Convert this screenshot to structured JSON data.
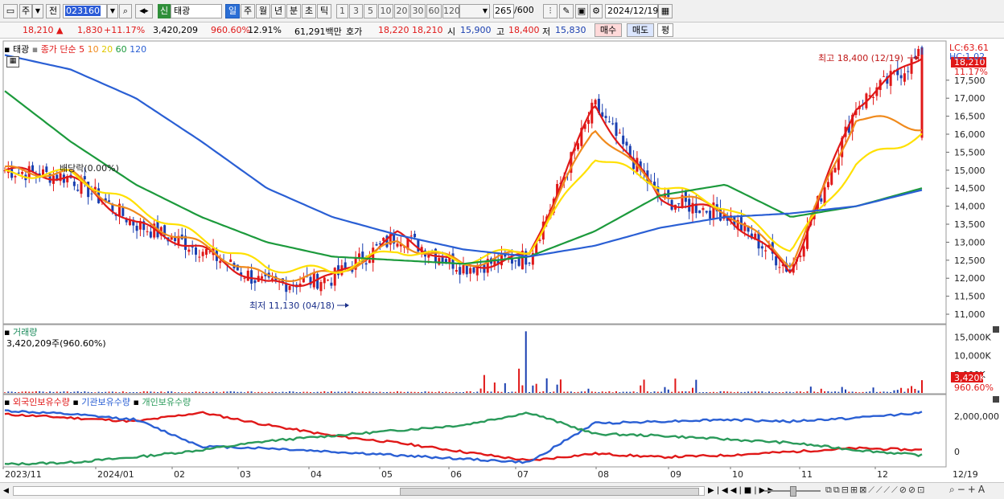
{
  "toolbar": {
    "market_btn": "주",
    "prev_btn": "전",
    "code": "023160",
    "new_badge": "신",
    "stock_name": "태광",
    "periods": [
      "일",
      "주",
      "월",
      "년",
      "분",
      "초",
      "틱"
    ],
    "active_period": "일",
    "nums": [
      "1",
      "3",
      "5",
      "10",
      "20",
      "30",
      "60",
      "120"
    ],
    "count": "265",
    "count_total": "/600",
    "date": "2024/12/19"
  },
  "info": {
    "price": "18,210",
    "change_arrow": "▲",
    "change": "1,830",
    "change_pct": "+11.17%",
    "volume": "3,420,209",
    "volume_ratio": "960.60%",
    "turnover": "12.91%",
    "amount": "61,291백만",
    "quote_label": "호가",
    "ask": "18,220",
    "bid": "18,210",
    "open_label": "시",
    "open": "15,900",
    "high_label": "고",
    "high": "18,400",
    "low_label": "저",
    "low": "15,830",
    "buy_btn": "매수",
    "sell_btn": "매도",
    "eval_btn": "평"
  },
  "price_panel": {
    "stock": "태광",
    "ma_title": "종가 단순",
    "ma_periods": [
      "5",
      "10",
      "20",
      "60",
      "120"
    ],
    "ma_colors": [
      "#e01818",
      "#f08a1c",
      "#ffe000",
      "#1c9a3c",
      "#2a5fd4"
    ],
    "lc": "LC:63.61",
    "hc": "HC:1.02",
    "current_price": "18,210",
    "current_pct": "11.17%",
    "allocation": "배당락(0.00%)",
    "high_note": "최고 18,400 (12/19)",
    "low_note": "최저 11,130 (04/18)",
    "y_ticks": [
      "17,500",
      "17,000",
      "16,500",
      "16,000",
      "15,500",
      "15,000",
      "14,500",
      "14,000",
      "13,500",
      "13,000",
      "12,500",
      "12,000",
      "11,500",
      "11,000"
    ]
  },
  "volume_panel": {
    "title": "거래량",
    "current": "3,420,209주(960.60%)",
    "y_ticks": [
      "15,000K",
      "10,000K",
      "5,000K"
    ],
    "badge": "3,420K",
    "badge_pct": "960.60%"
  },
  "holding_panel": {
    "legend": [
      "외국인보유수량",
      "기관보유수량",
      "개인보유수량"
    ],
    "colors": [
      "#e01818",
      "#2a5fd4",
      "#2a9a5a"
    ],
    "y_ticks": [
      "2,000,000",
      "0"
    ]
  },
  "x_labels": [
    "2023/11",
    "2024/01",
    "02",
    "03",
    "04",
    "05",
    "06",
    "07",
    "08",
    "09",
    "10",
    "11",
    "12",
    "12/19"
  ],
  "chart_data": {
    "type": "line",
    "title": "태광 종가 단순이동평균",
    "x": [
      "2023/11",
      "2023/12",
      "2024/01",
      "02",
      "03",
      "04",
      "05",
      "06",
      "07",
      "08",
      "09",
      "10",
      "11",
      "12",
      "12/19"
    ],
    "series": [
      {
        "name": "5",
        "values": [
          15000,
          14800,
          13500,
          12800,
          11800,
          12000,
          13200,
          12300,
          12600,
          16800,
          14200,
          13800,
          12200,
          16800,
          18210
        ]
      },
      {
        "name": "10",
        "values": [
          15000,
          14900,
          13700,
          12900,
          12000,
          12100,
          13000,
          12400,
          12700,
          16200,
          14400,
          13900,
          12400,
          16500,
          16200
        ]
      },
      {
        "name": "20",
        "values": [
          14900,
          14900,
          14000,
          13100,
          12300,
          12200,
          12800,
          12500,
          12800,
          15400,
          14600,
          14000,
          12800,
          15200,
          16000
        ]
      },
      {
        "name": "60",
        "values": [
          17200,
          15800,
          14600,
          13700,
          13000,
          12600,
          12500,
          12400,
          12600,
          13300,
          14300,
          14600,
          13700,
          14000,
          14500
        ]
      },
      {
        "name": "120",
        "values": [
          18200,
          17800,
          17000,
          15800,
          14500,
          13700,
          13200,
          12800,
          12600,
          12900,
          13400,
          13700,
          13800,
          14000,
          14450
        ]
      }
    ],
    "ylim": [
      10800,
      18500
    ],
    "high": {
      "value": 18400,
      "date": "12/19"
    },
    "low": {
      "value": 11130,
      "date": "04/18"
    },
    "volume": {
      "current": 3420209,
      "peak_month": "06",
      "ylim": [
        0,
        17000000
      ]
    },
    "holdings": {
      "ylim": [
        -800000,
        2800000
      ]
    }
  }
}
